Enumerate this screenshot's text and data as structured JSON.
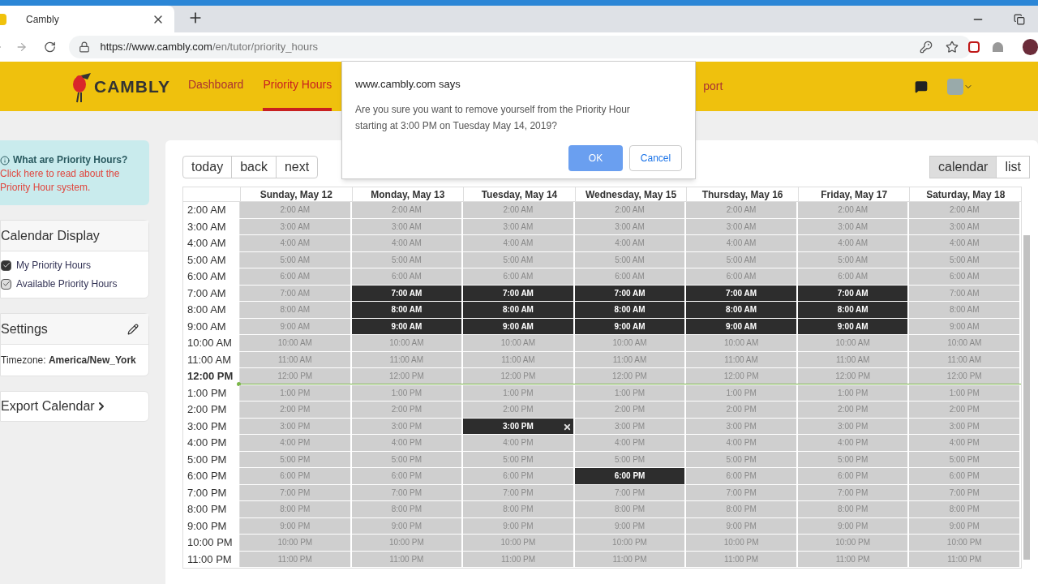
{
  "browser": {
    "tab_title": "Cambly",
    "url_host": "https://www.cambly.com",
    "url_path": "/en/tutor/priority_hours"
  },
  "nav": {
    "logo": "CAMBLY",
    "items": [
      {
        "label": "Dashboard",
        "selected": false
      },
      {
        "label": "Priority Hours",
        "selected": true
      }
    ],
    "partial_item": "port"
  },
  "dialog": {
    "title": "www.cambly.com says",
    "message": "Are you sure you want to remove yourself from the Priority Hour starting at 3:00 PM on Tuesday May 14, 2019?",
    "ok": "OK",
    "cancel": "Cancel"
  },
  "info": {
    "title": "What are Priority Hours?",
    "link": "Click here to read about the Priority Hour system."
  },
  "calendar_display": {
    "title": "Calendar Display",
    "options": [
      {
        "label": "My Priority Hours",
        "checked": true
      },
      {
        "label": "Available Priority Hours",
        "checked": true
      }
    ]
  },
  "settings": {
    "title": "Settings",
    "timezone_label": "Timezone:",
    "timezone": "America/New_York"
  },
  "export": {
    "label": "Export Calendar"
  },
  "toolbar": {
    "nav_buttons": [
      "today",
      "back",
      "next"
    ],
    "views": [
      {
        "label": "calendar",
        "selected": true
      },
      {
        "label": "list",
        "selected": false
      }
    ]
  },
  "days": [
    "Sunday, May 12",
    "Monday, May 13",
    "Tuesday, May 14",
    "Wednesday, May 15",
    "Thursday, May 16",
    "Friday, May 17",
    "Saturday, May 18"
  ],
  "rows": [
    {
      "time": "2:00 AM",
      "current": false,
      "cells": [
        {
          "label": "2:00 AM",
          "booked": false,
          "removable": false
        },
        {
          "label": "2:00 AM",
          "booked": false,
          "removable": false
        },
        {
          "label": "2:00 AM",
          "booked": false,
          "removable": false
        },
        {
          "label": "2:00 AM",
          "booked": false,
          "removable": false
        },
        {
          "label": "2:00 AM",
          "booked": false,
          "removable": false
        },
        {
          "label": "2:00 AM",
          "booked": false,
          "removable": false
        },
        {
          "label": "2:00 AM",
          "booked": false,
          "removable": false
        }
      ]
    },
    {
      "time": "3:00 AM",
      "current": false,
      "cells": [
        {
          "label": "3:00 AM",
          "booked": false,
          "removable": false
        },
        {
          "label": "3:00 AM",
          "booked": false,
          "removable": false
        },
        {
          "label": "3:00 AM",
          "booked": false,
          "removable": false
        },
        {
          "label": "3:00 AM",
          "booked": false,
          "removable": false
        },
        {
          "label": "3:00 AM",
          "booked": false,
          "removable": false
        },
        {
          "label": "3:00 AM",
          "booked": false,
          "removable": false
        },
        {
          "label": "3:00 AM",
          "booked": false,
          "removable": false
        }
      ]
    },
    {
      "time": "4:00 AM",
      "current": false,
      "cells": [
        {
          "label": "4:00 AM",
          "booked": false,
          "removable": false
        },
        {
          "label": "4:00 AM",
          "booked": false,
          "removable": false
        },
        {
          "label": "4:00 AM",
          "booked": false,
          "removable": false
        },
        {
          "label": "4:00 AM",
          "booked": false,
          "removable": false
        },
        {
          "label": "4:00 AM",
          "booked": false,
          "removable": false
        },
        {
          "label": "4:00 AM",
          "booked": false,
          "removable": false
        },
        {
          "label": "4:00 AM",
          "booked": false,
          "removable": false
        }
      ]
    },
    {
      "time": "5:00 AM",
      "current": false,
      "cells": [
        {
          "label": "5:00 AM",
          "booked": false,
          "removable": false
        },
        {
          "label": "5:00 AM",
          "booked": false,
          "removable": false
        },
        {
          "label": "5:00 AM",
          "booked": false,
          "removable": false
        },
        {
          "label": "5:00 AM",
          "booked": false,
          "removable": false
        },
        {
          "label": "5:00 AM",
          "booked": false,
          "removable": false
        },
        {
          "label": "5:00 AM",
          "booked": false,
          "removable": false
        },
        {
          "label": "5:00 AM",
          "booked": false,
          "removable": false
        }
      ]
    },
    {
      "time": "6:00 AM",
      "current": false,
      "cells": [
        {
          "label": "6:00 AM",
          "booked": false,
          "removable": false
        },
        {
          "label": "6:00 AM",
          "booked": false,
          "removable": false
        },
        {
          "label": "6:00 AM",
          "booked": false,
          "removable": false
        },
        {
          "label": "6:00 AM",
          "booked": false,
          "removable": false
        },
        {
          "label": "6:00 AM",
          "booked": false,
          "removable": false
        },
        {
          "label": "6:00 AM",
          "booked": false,
          "removable": false
        },
        {
          "label": "6:00 AM",
          "booked": false,
          "removable": false
        }
      ]
    },
    {
      "time": "7:00 AM",
      "current": false,
      "cells": [
        {
          "label": "7:00 AM",
          "booked": false,
          "removable": false
        },
        {
          "label": "7:00 AM",
          "booked": true,
          "removable": false
        },
        {
          "label": "7:00 AM",
          "booked": true,
          "removable": false
        },
        {
          "label": "7:00 AM",
          "booked": true,
          "removable": false
        },
        {
          "label": "7:00 AM",
          "booked": true,
          "removable": false
        },
        {
          "label": "7:00 AM",
          "booked": true,
          "removable": false
        },
        {
          "label": "7:00 AM",
          "booked": false,
          "removable": false
        }
      ]
    },
    {
      "time": "8:00 AM",
      "current": false,
      "cells": [
        {
          "label": "8:00 AM",
          "booked": false,
          "removable": false
        },
        {
          "label": "8:00 AM",
          "booked": true,
          "removable": false
        },
        {
          "label": "8:00 AM",
          "booked": true,
          "removable": false
        },
        {
          "label": "8:00 AM",
          "booked": true,
          "removable": false
        },
        {
          "label": "8:00 AM",
          "booked": true,
          "removable": false
        },
        {
          "label": "8:00 AM",
          "booked": true,
          "removable": false
        },
        {
          "label": "8:00 AM",
          "booked": false,
          "removable": false
        }
      ]
    },
    {
      "time": "9:00 AM",
      "current": false,
      "cells": [
        {
          "label": "9:00 AM",
          "booked": false,
          "removable": false
        },
        {
          "label": "9:00 AM",
          "booked": true,
          "removable": false
        },
        {
          "label": "9:00 AM",
          "booked": true,
          "removable": false
        },
        {
          "label": "9:00 AM",
          "booked": true,
          "removable": false
        },
        {
          "label": "9:00 AM",
          "booked": true,
          "removable": false
        },
        {
          "label": "9:00 AM",
          "booked": true,
          "removable": false
        },
        {
          "label": "9:00 AM",
          "booked": false,
          "removable": false
        }
      ]
    },
    {
      "time": "10:00 AM",
      "current": false,
      "cells": [
        {
          "label": "10:00 AM",
          "booked": false,
          "removable": false
        },
        {
          "label": "10:00 AM",
          "booked": false,
          "removable": false
        },
        {
          "label": "10:00 AM",
          "booked": false,
          "removable": false
        },
        {
          "label": "10:00 AM",
          "booked": false,
          "removable": false
        },
        {
          "label": "10:00 AM",
          "booked": false,
          "removable": false
        },
        {
          "label": "10:00 AM",
          "booked": false,
          "removable": false
        },
        {
          "label": "10:00 AM",
          "booked": false,
          "removable": false
        }
      ]
    },
    {
      "time": "11:00 AM",
      "current": false,
      "cells": [
        {
          "label": "11:00 AM",
          "booked": false,
          "removable": false
        },
        {
          "label": "11:00 AM",
          "booked": false,
          "removable": false
        },
        {
          "label": "11:00 AM",
          "booked": false,
          "removable": false
        },
        {
          "label": "11:00 AM",
          "booked": false,
          "removable": false
        },
        {
          "label": "11:00 AM",
          "booked": false,
          "removable": false
        },
        {
          "label": "11:00 AM",
          "booked": false,
          "removable": false
        },
        {
          "label": "11:00 AM",
          "booked": false,
          "removable": false
        }
      ]
    },
    {
      "time": "12:00 PM",
      "current": true,
      "cells": [
        {
          "label": "12:00 PM",
          "booked": false,
          "removable": false
        },
        {
          "label": "12:00 PM",
          "booked": false,
          "removable": false
        },
        {
          "label": "12:00 PM",
          "booked": false,
          "removable": false
        },
        {
          "label": "12:00 PM",
          "booked": false,
          "removable": false
        },
        {
          "label": "12:00 PM",
          "booked": false,
          "removable": false
        },
        {
          "label": "12:00 PM",
          "booked": false,
          "removable": false
        },
        {
          "label": "12:00 PM",
          "booked": false,
          "removable": false
        }
      ]
    },
    {
      "time": "1:00 PM",
      "current": false,
      "cells": [
        {
          "label": "1:00 PM",
          "booked": false,
          "removable": false
        },
        {
          "label": "1:00 PM",
          "booked": false,
          "removable": false
        },
        {
          "label": "1:00 PM",
          "booked": false,
          "removable": false
        },
        {
          "label": "1:00 PM",
          "booked": false,
          "removable": false
        },
        {
          "label": "1:00 PM",
          "booked": false,
          "removable": false
        },
        {
          "label": "1:00 PM",
          "booked": false,
          "removable": false
        },
        {
          "label": "1:00 PM",
          "booked": false,
          "removable": false
        }
      ]
    },
    {
      "time": "2:00 PM",
      "current": false,
      "cells": [
        {
          "label": "2:00 PM",
          "booked": false,
          "removable": false
        },
        {
          "label": "2:00 PM",
          "booked": false,
          "removable": false
        },
        {
          "label": "2:00 PM",
          "booked": false,
          "removable": false
        },
        {
          "label": "2:00 PM",
          "booked": false,
          "removable": false
        },
        {
          "label": "2:00 PM",
          "booked": false,
          "removable": false
        },
        {
          "label": "2:00 PM",
          "booked": false,
          "removable": false
        },
        {
          "label": "2:00 PM",
          "booked": false,
          "removable": false
        }
      ]
    },
    {
      "time": "3:00 PM",
      "current": false,
      "cells": [
        {
          "label": "3:00 PM",
          "booked": false,
          "removable": false
        },
        {
          "label": "3:00 PM",
          "booked": false,
          "removable": false
        },
        {
          "label": "3:00 PM",
          "booked": true,
          "removable": true
        },
        {
          "label": "3:00 PM",
          "booked": false,
          "removable": false
        },
        {
          "label": "3:00 PM",
          "booked": false,
          "removable": false
        },
        {
          "label": "3:00 PM",
          "booked": false,
          "removable": false
        },
        {
          "label": "3:00 PM",
          "booked": false,
          "removable": false
        }
      ]
    },
    {
      "time": "4:00 PM",
      "current": false,
      "cells": [
        {
          "label": "4:00 PM",
          "booked": false,
          "removable": false
        },
        {
          "label": "4:00 PM",
          "booked": false,
          "removable": false
        },
        {
          "label": "4:00 PM",
          "booked": false,
          "removable": false
        },
        {
          "label": "4:00 PM",
          "booked": false,
          "removable": false
        },
        {
          "label": "4:00 PM",
          "booked": false,
          "removable": false
        },
        {
          "label": "4:00 PM",
          "booked": false,
          "removable": false
        },
        {
          "label": "4:00 PM",
          "booked": false,
          "removable": false
        }
      ]
    },
    {
      "time": "5:00 PM",
      "current": false,
      "cells": [
        {
          "label": "5:00 PM",
          "booked": false,
          "removable": false
        },
        {
          "label": "5:00 PM",
          "booked": false,
          "removable": false
        },
        {
          "label": "5:00 PM",
          "booked": false,
          "removable": false
        },
        {
          "label": "5:00 PM",
          "booked": false,
          "removable": false
        },
        {
          "label": "5:00 PM",
          "booked": false,
          "removable": false
        },
        {
          "label": "5:00 PM",
          "booked": false,
          "removable": false
        },
        {
          "label": "5:00 PM",
          "booked": false,
          "removable": false
        }
      ]
    },
    {
      "time": "6:00 PM",
      "current": false,
      "cells": [
        {
          "label": "6:00 PM",
          "booked": false,
          "removable": false
        },
        {
          "label": "6:00 PM",
          "booked": false,
          "removable": false
        },
        {
          "label": "6:00 PM",
          "booked": false,
          "removable": false
        },
        {
          "label": "6:00 PM",
          "booked": true,
          "removable": false
        },
        {
          "label": "6:00 PM",
          "booked": false,
          "removable": false
        },
        {
          "label": "6:00 PM",
          "booked": false,
          "removable": false
        },
        {
          "label": "6:00 PM",
          "booked": false,
          "removable": false
        }
      ]
    },
    {
      "time": "7:00 PM",
      "current": false,
      "cells": [
        {
          "label": "7:00 PM",
          "booked": false,
          "removable": false
        },
        {
          "label": "7:00 PM",
          "booked": false,
          "removable": false
        },
        {
          "label": "7:00 PM",
          "booked": false,
          "removable": false
        },
        {
          "label": "7:00 PM",
          "booked": false,
          "removable": false
        },
        {
          "label": "7:00 PM",
          "booked": false,
          "removable": false
        },
        {
          "label": "7:00 PM",
          "booked": false,
          "removable": false
        },
        {
          "label": "7:00 PM",
          "booked": false,
          "removable": false
        }
      ]
    },
    {
      "time": "8:00 PM",
      "current": false,
      "cells": [
        {
          "label": "8:00 PM",
          "booked": false,
          "removable": false
        },
        {
          "label": "8:00 PM",
          "booked": false,
          "removable": false
        },
        {
          "label": "8:00 PM",
          "booked": false,
          "removable": false
        },
        {
          "label": "8:00 PM",
          "booked": false,
          "removable": false
        },
        {
          "label": "8:00 PM",
          "booked": false,
          "removable": false
        },
        {
          "label": "8:00 PM",
          "booked": false,
          "removable": false
        },
        {
          "label": "8:00 PM",
          "booked": false,
          "removable": false
        }
      ]
    },
    {
      "time": "9:00 PM",
      "current": false,
      "cells": [
        {
          "label": "9:00 PM",
          "booked": false,
          "removable": false
        },
        {
          "label": "9:00 PM",
          "booked": false,
          "removable": false
        },
        {
          "label": "9:00 PM",
          "booked": false,
          "removable": false
        },
        {
          "label": "9:00 PM",
          "booked": false,
          "removable": false
        },
        {
          "label": "9:00 PM",
          "booked": false,
          "removable": false
        },
        {
          "label": "9:00 PM",
          "booked": false,
          "removable": false
        },
        {
          "label": "9:00 PM",
          "booked": false,
          "removable": false
        }
      ]
    },
    {
      "time": "10:00 PM",
      "current": false,
      "cells": [
        {
          "label": "10:00 PM",
          "booked": false,
          "removable": false
        },
        {
          "label": "10:00 PM",
          "booked": false,
          "removable": false
        },
        {
          "label": "10:00 PM",
          "booked": false,
          "removable": false
        },
        {
          "label": "10:00 PM",
          "booked": false,
          "removable": false
        },
        {
          "label": "10:00 PM",
          "booked": false,
          "removable": false
        },
        {
          "label": "10:00 PM",
          "booked": false,
          "removable": false
        },
        {
          "label": "10:00 PM",
          "booked": false,
          "removable": false
        }
      ]
    },
    {
      "time": "11:00 PM",
      "current": false,
      "cells": [
        {
          "label": "11:00 PM",
          "booked": false,
          "removable": false
        },
        {
          "label": "11:00 PM",
          "booked": false,
          "removable": false
        },
        {
          "label": "11:00 PM",
          "booked": false,
          "removable": false
        },
        {
          "label": "11:00 PM",
          "booked": false,
          "removable": false
        },
        {
          "label": "11:00 PM",
          "booked": false,
          "removable": false
        },
        {
          "label": "11:00 PM",
          "booked": false,
          "removable": false
        },
        {
          "label": "11:00 PM",
          "booked": false,
          "removable": false
        }
      ]
    }
  ]
}
